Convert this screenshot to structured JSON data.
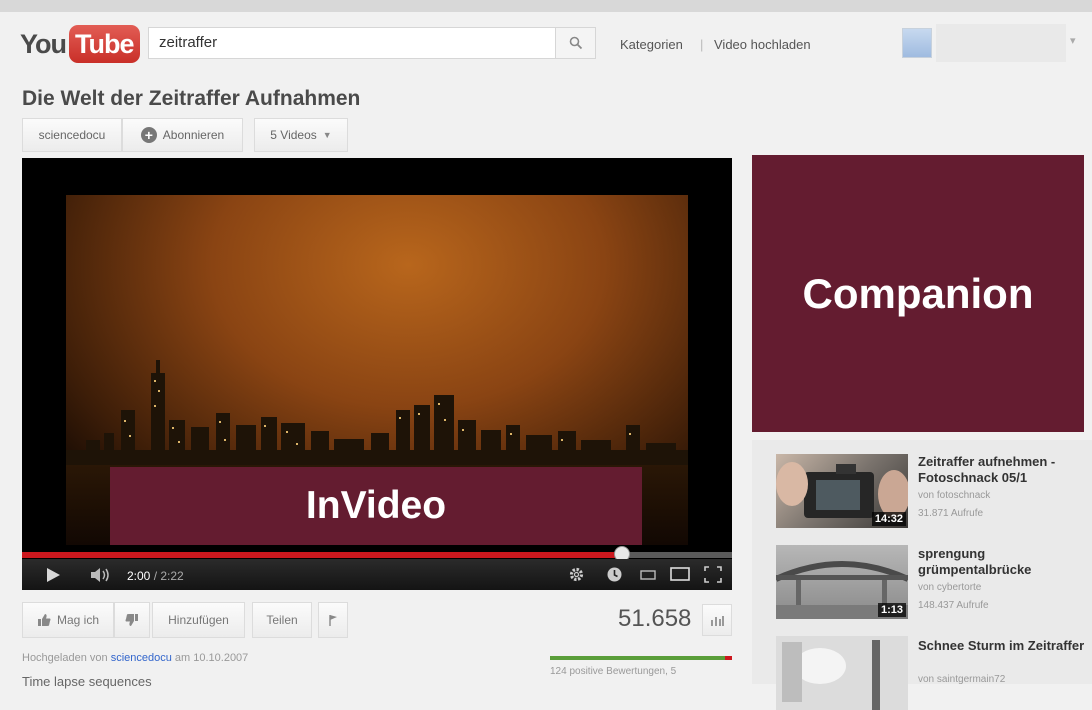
{
  "logo": {
    "part1": "You",
    "part2": "Tube"
  },
  "search": {
    "value": "zeitraffer"
  },
  "nav": {
    "categories": "Kategorien",
    "separator": "|",
    "upload": "Video hochladen"
  },
  "video": {
    "title": "Die Welt der Zeitraffer Aufnahmen",
    "channel": "sciencedocu",
    "subscribe": "Abonnieren",
    "videos_count": "5 Videos",
    "overlay_ad": "InVideo",
    "time_current": "2:00",
    "time_total": "/ 2:22",
    "progress_fraction": 0.845
  },
  "actions": {
    "like": "Mag ich",
    "add": "Hinzufügen",
    "share": "Teilen",
    "views": "51.658"
  },
  "info": {
    "uploaded_prefix": "Hochgeladen von",
    "uploader": "sciencedocu",
    "uploaded_suffix": "am 10.10.2007",
    "description": "Time lapse sequences",
    "ratings_text": "124 positive Bewertungen, 5",
    "positive_fraction": 0.96
  },
  "sidebar": {
    "companion_ad": "Companion",
    "related": [
      {
        "title": "Zeitraffer aufnehmen - Fotoschnack 05/1",
        "author": "von fotoschnack",
        "views": "31.871 Aufrufe",
        "duration": "14:32"
      },
      {
        "title": "sprengung grümpentalbrücke",
        "author": "von cybertorte",
        "views": "148.437 Aufrufe",
        "duration": "1:13"
      },
      {
        "title": "Schnee Sturm im Zeitraffer",
        "author": "von saintgermain72",
        "views": "",
        "duration": ""
      }
    ]
  },
  "colors": {
    "ad_bg": "#641c30",
    "progress": "#cc181e",
    "rating_positive": "#5a9e3a"
  }
}
